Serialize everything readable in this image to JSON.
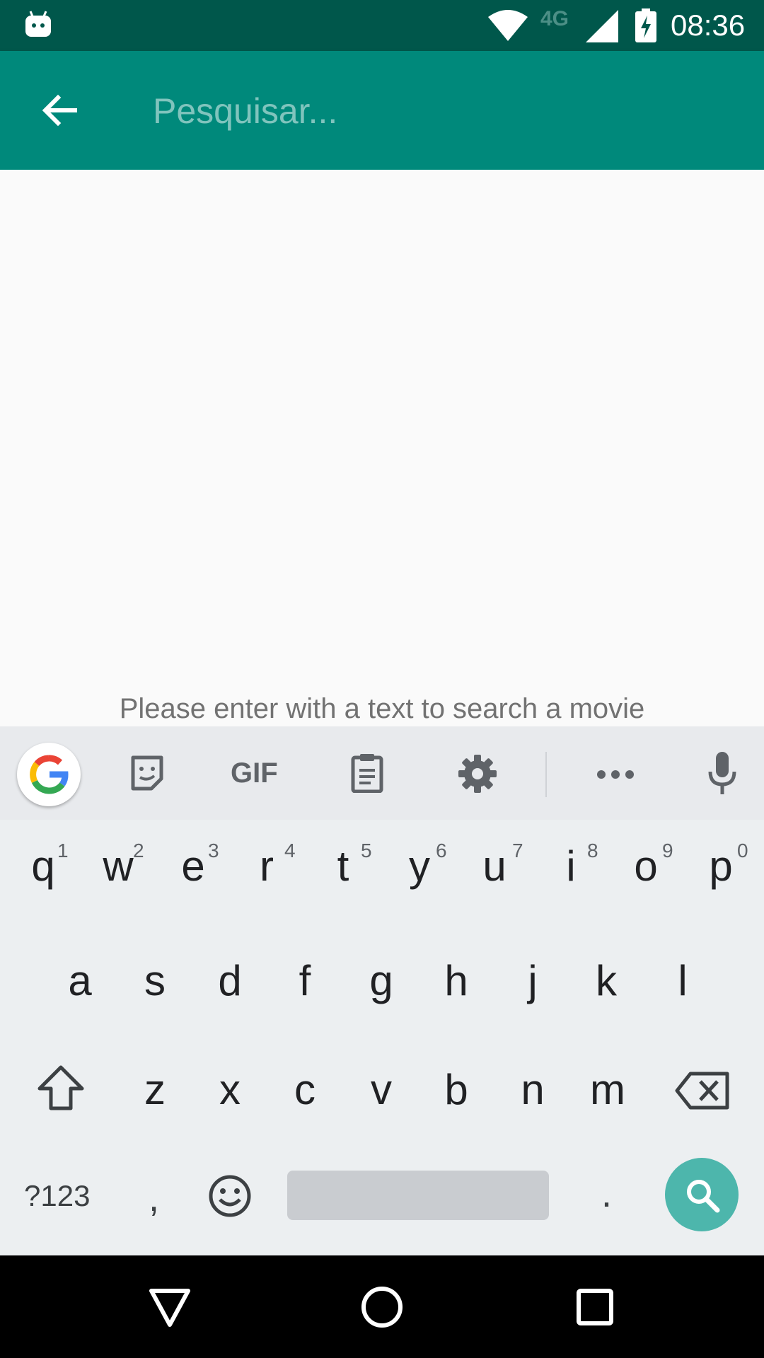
{
  "status_bar": {
    "time": "08:36",
    "network": "4G",
    "icons": [
      "android-icon",
      "wifi-icon",
      "signal-icon",
      "battery-charging-icon"
    ]
  },
  "app_bar": {
    "search_placeholder": "Pesquisar...",
    "back_icon": "arrow-back-icon"
  },
  "content": {
    "empty_message": "Please enter with a text to search a movie"
  },
  "keyboard": {
    "toolbar": {
      "items": [
        "google-icon",
        "sticker-icon",
        "GIF",
        "clipboard-icon",
        "settings-icon",
        "more-icon",
        "microphone-icon"
      ],
      "gif_label": "GIF"
    },
    "row1": [
      {
        "letter": "q",
        "hint": "1"
      },
      {
        "letter": "w",
        "hint": "2"
      },
      {
        "letter": "e",
        "hint": "3"
      },
      {
        "letter": "r",
        "hint": "4"
      },
      {
        "letter": "t",
        "hint": "5"
      },
      {
        "letter": "y",
        "hint": "6"
      },
      {
        "letter": "u",
        "hint": "7"
      },
      {
        "letter": "i",
        "hint": "8"
      },
      {
        "letter": "o",
        "hint": "9"
      },
      {
        "letter": "p",
        "hint": "0"
      }
    ],
    "row2": [
      "a",
      "s",
      "d",
      "f",
      "g",
      "h",
      "j",
      "k",
      "l"
    ],
    "row3": [
      "z",
      "x",
      "c",
      "v",
      "b",
      "n",
      "m"
    ],
    "row4": {
      "symbols_label": "?123",
      "comma": ",",
      "period": "."
    },
    "accent_color": "#4db6ac"
  },
  "nav_bar": {
    "icons": [
      "back-triangle-icon",
      "home-circle-icon",
      "recents-square-icon"
    ]
  },
  "colors": {
    "status_bar": "#00574b",
    "app_bar": "#00897b"
  }
}
